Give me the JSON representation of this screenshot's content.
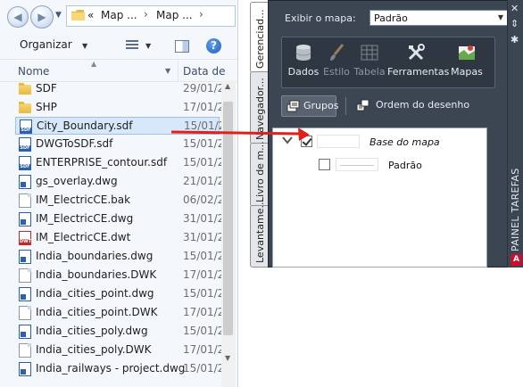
{
  "explorer": {
    "address": {
      "overflow": "«",
      "crumbs": [
        "Map ...",
        "Map ..."
      ],
      "separator": "›"
    },
    "toolbar": {
      "organize_label": "Organizar"
    },
    "columns": {
      "name": "Nome",
      "date": "Data de"
    },
    "files": [
      {
        "name": "SDF",
        "date": "29/01/2",
        "icon": "folder-icon"
      },
      {
        "name": "SHP",
        "date": "17/01/2",
        "icon": "folder-icon"
      },
      {
        "name": "City_Boundary.sdf",
        "date": "15/01/2",
        "icon": "sdf-file-icon",
        "selected": true
      },
      {
        "name": "DWGToSDF.sdf",
        "date": "15/01/2",
        "icon": "sdf-file-icon"
      },
      {
        "name": "ENTERPRISE_contour.sdf",
        "date": "15/01/2",
        "icon": "sdf-file-icon"
      },
      {
        "name": "gs_overlay.dwg",
        "date": "21/01/2",
        "icon": "dwg-file-icon"
      },
      {
        "name": "IM_ElectricCE.bak",
        "date": "06/02/2",
        "icon": "document-icon"
      },
      {
        "name": "IM_ElectricCE.dwg",
        "date": "31/01/2",
        "icon": "dwg-file-icon"
      },
      {
        "name": "IM_ElectricCE.dwt",
        "date": "31/01/2",
        "icon": "dwt-file-icon"
      },
      {
        "name": "India_boundaries.dwg",
        "date": "15/01/2",
        "icon": "dwg-file-icon"
      },
      {
        "name": "India_boundaries.DWK",
        "date": "17/01/2",
        "icon": "document-icon"
      },
      {
        "name": "India_cities_point.dwg",
        "date": "15/01/2",
        "icon": "dwg-file-icon"
      },
      {
        "name": "India_cities_point.DWK",
        "date": "17/01/2",
        "icon": "document-icon"
      },
      {
        "name": "India_cities_poly.dwg",
        "date": "15/01/2",
        "icon": "dwg-file-icon"
      },
      {
        "name": "India_cities_poly.DWK",
        "date": "17/01/2",
        "icon": "document-icon"
      },
      {
        "name": "India_railways - project.dwg",
        "date": "15/01/2",
        "icon": "dwg-file-icon"
      }
    ]
  },
  "taskpane": {
    "side_tabs": [
      "Gerenciad...",
      "Navegador...",
      "Livro de m...",
      "Levantame..."
    ],
    "map_label": "Exibir o mapa:",
    "map_value": "Padrão",
    "ribbon": [
      {
        "label": "Dados",
        "icon": "database-icon",
        "enabled": true
      },
      {
        "label": "Estilo",
        "icon": "brush-icon",
        "enabled": false
      },
      {
        "label": "Tabela",
        "icon": "table-icon",
        "enabled": false
      },
      {
        "label": "Ferramentas",
        "icon": "tools-icon",
        "enabled": true
      },
      {
        "label": "Mapas",
        "icon": "maps-icon",
        "enabled": true
      }
    ],
    "groups_label": "Grupos",
    "draw_order_label": "Ordem do desenho",
    "layers": [
      {
        "name": "Base do mapa",
        "checked": true,
        "italic": true
      },
      {
        "name": "Padrão",
        "checked": false,
        "italic": false
      }
    ],
    "vertical_title": "PAINEL TAREFAS",
    "logo_letter": "A"
  },
  "colors": {
    "pane_bg": "#3c4653",
    "arrow": "#e0201b",
    "selection": "#d8e8fb"
  }
}
